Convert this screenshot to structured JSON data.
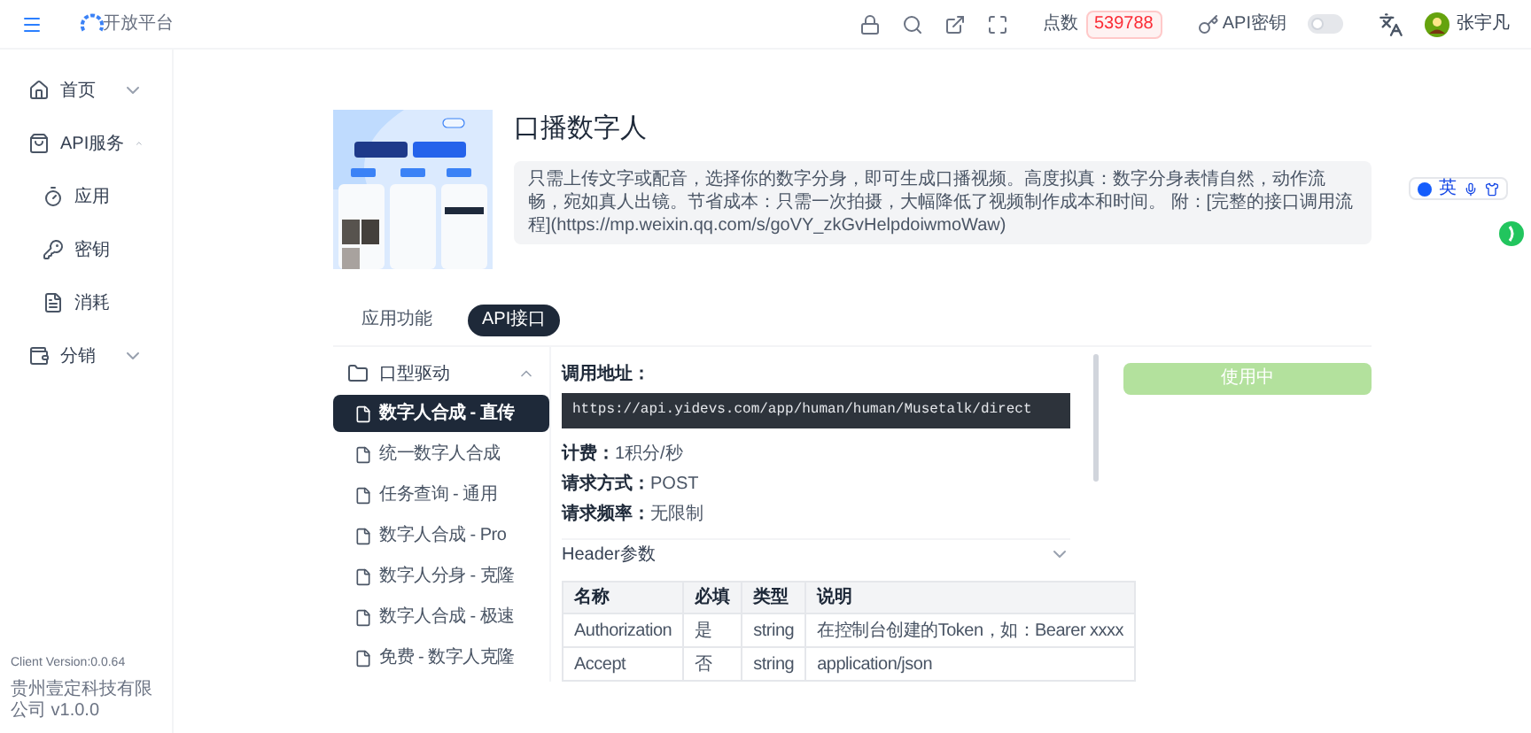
{
  "header": {
    "logo_text": "开放平台",
    "points_label": "点数",
    "points": "539788",
    "api_key_label": "API密钥",
    "dark_mode": {
      "on": false
    },
    "user": "张宇凡"
  },
  "sidebar": {
    "items": [
      {
        "label": "首页",
        "expanded": false
      },
      {
        "label": "API服务",
        "expanded": true,
        "children": [
          {
            "label": "应用"
          },
          {
            "label": "密钥"
          },
          {
            "label": "消耗"
          }
        ]
      },
      {
        "label": "分销",
        "expanded": false
      }
    ]
  },
  "footer": {
    "version": "Client Version:0.0.64",
    "company": "贵州壹定科技有限公司 v1.0.0"
  },
  "product": {
    "title": "口播数字人",
    "description": "只需上传文字或配音，选择你的数字分身，即可生成口播视频。高度拟真：数字分身表情自然，动作流畅，宛如真人出镜。节省成本：只需一次拍摄，大幅降低了视频制作成本和时间。 附：[完整的接口调用流程](https://mp.weixin.qq.com/s/goVY_zkGvHelpdoiwmoWaw)"
  },
  "tabs": [
    {
      "label": "应用功能",
      "selected": false
    },
    {
      "label": "API接口",
      "selected": true
    }
  ],
  "api_tree": {
    "group": {
      "label": "口型驱动",
      "expanded": true
    },
    "items": [
      {
        "label": "数字人合成 - 直传",
        "selected": true
      },
      {
        "label": "统一数字人合成",
        "selected": false
      },
      {
        "label": "任务查询 - 通用",
        "selected": false
      },
      {
        "label": "数字人合成 - Pro",
        "selected": false
      },
      {
        "label": "数字人分身 - 克隆",
        "selected": false
      },
      {
        "label": "数字人合成 - 极速",
        "selected": false
      },
      {
        "label": "免费 - 数字人克隆",
        "selected": false
      }
    ]
  },
  "detail": {
    "url_label": "调用地址：",
    "url": "https://api.yidevs.com/app/human/human/Musetalk/direct",
    "fields": [
      {
        "label": "计费：",
        "value": "1积分/秒"
      },
      {
        "label": "请求方式：",
        "value": "POST"
      },
      {
        "label": "请求频率：",
        "value": "无限制"
      }
    ],
    "header_section": {
      "title": "Header参数",
      "expanded": true
    },
    "table": {
      "columns": [
        "名称",
        "必填",
        "类型",
        "说明"
      ],
      "rows": [
        [
          "Authorization",
          "是",
          "string",
          "在控制台创建的Token，如：Bearer xxxx"
        ],
        [
          "Accept",
          "否",
          "string",
          "application/json"
        ]
      ]
    }
  },
  "use_button": {
    "label": "使用中",
    "disabled": true
  },
  "ime_toolbar": {
    "label": "英"
  }
}
